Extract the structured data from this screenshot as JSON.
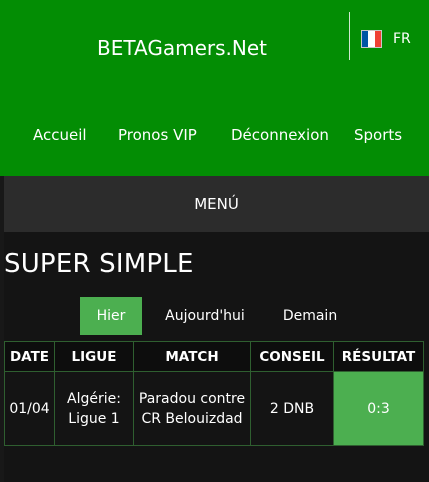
{
  "header": {
    "site_title": "BETAGamers.Net",
    "language": {
      "label": "FR",
      "flag_colors": [
        "#0055a4",
        "#ffffff",
        "#ef4135"
      ]
    },
    "nav": [
      {
        "label": "Accueil"
      },
      {
        "label": "Pronos VIP"
      },
      {
        "label": "Déconnexion"
      },
      {
        "label": "Sports"
      }
    ],
    "background_color": "#038d04"
  },
  "menu": {
    "label": "MENÚ"
  },
  "section": {
    "title": "SUPER SIMPLE",
    "tabs": [
      {
        "label": "Hier",
        "active": true
      },
      {
        "label": "Aujourd'hui",
        "active": false
      },
      {
        "label": "Demain",
        "active": false
      }
    ],
    "accent_color": "#4caf50"
  },
  "table": {
    "columns": [
      "DATE",
      "LIGUE",
      "MATCH",
      "CONSEIL",
      "RÉSULTAT"
    ],
    "rows": [
      {
        "date": "01/04",
        "league": "Algérie: Ligue 1",
        "match": "Paradou contre CR Belouizdad",
        "advice": "2 DNB",
        "result": "0:3"
      }
    ]
  }
}
